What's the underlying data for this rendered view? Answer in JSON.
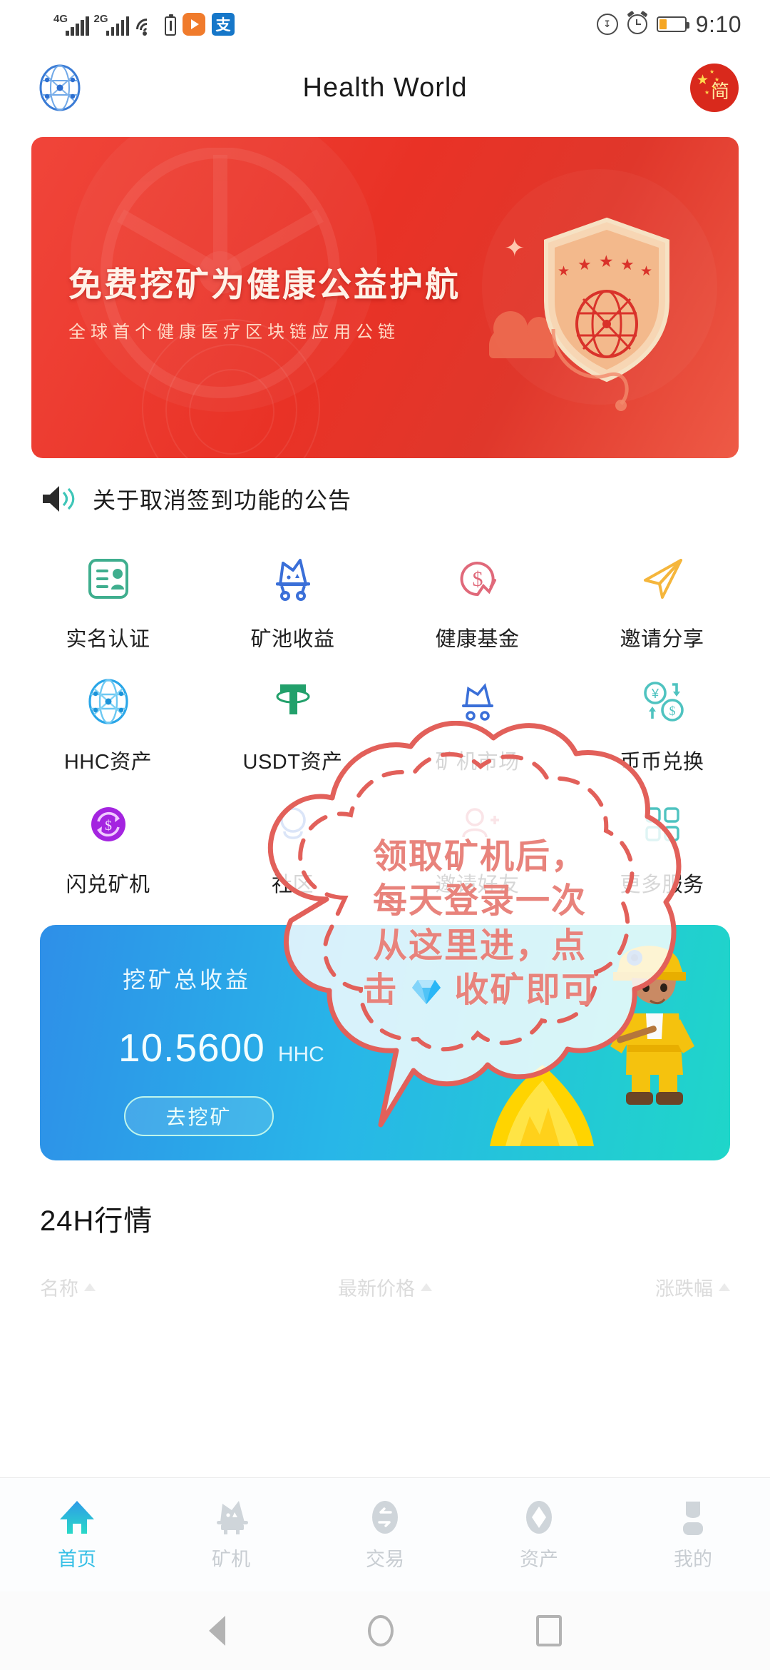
{
  "statusbar": {
    "signal1": "4G",
    "signal2": "2G",
    "wifi_icon": "wifi-icon",
    "battery_icon": "battery-low-icon",
    "app_icons": [
      "video-player-app-icon",
      "alipay-app-icon"
    ],
    "eco_icon": "eco-mode-icon",
    "alarm_icon": "alarm-clock-icon",
    "battery2_icon": "battery-icon",
    "time": "9:10"
  },
  "header": {
    "logo": "hhc-globe-logo",
    "title": "Health World",
    "language_button": "简"
  },
  "banner": {
    "headline": "免费挖矿为健康公益护航",
    "subhead": "全球首个健康医疗区块链应用公链",
    "shield_icon": "shield-badge-icon"
  },
  "announcement": {
    "icon": "speaker-icon",
    "text": "关于取消签到功能的公告"
  },
  "grid": {
    "items": [
      {
        "label": "实名认证",
        "icon": "id-card-icon",
        "color": "#3FAE8E"
      },
      {
        "label": "矿池收益",
        "icon": "mining-cart-icon",
        "color": "#3A6FD8"
      },
      {
        "label": "健康基金",
        "icon": "dollar-fund-icon",
        "color": "#E0697A"
      },
      {
        "label": "邀请分享",
        "icon": "paper-plane-icon",
        "color": "#F5B63C"
      },
      {
        "label": "HHC资产",
        "icon": "hhc-globe-icon",
        "color": "#29A6E8"
      },
      {
        "label": "USDT资产",
        "icon": "usdt-tether-icon",
        "color": "#22A06B"
      },
      {
        "label": "矿机市场",
        "icon": "miner-market-icon",
        "color": "#3A6FD8"
      },
      {
        "label": "币币兑换",
        "icon": "currency-exchange-icon",
        "color": "#4FC3C0"
      },
      {
        "label": "闪兑矿机",
        "icon": "flash-swap-icon",
        "color": "#A424E0"
      },
      {
        "label": "社区",
        "icon": "community-icon",
        "color": "#3A6FD8"
      },
      {
        "label": "邀请好友",
        "icon": "invite-friend-icon",
        "color": "#E0697A"
      },
      {
        "label": "更多服务",
        "icon": "more-services-icon",
        "color": "#4FC3C0"
      }
    ]
  },
  "mining_card": {
    "title": "挖矿总收益",
    "amount": "10.5600",
    "unit": "HHC",
    "button": "去挖矿",
    "miner_icon": "miner-character",
    "gold_icon": "gold-pile"
  },
  "tip_bubble": {
    "line1": "领取矿机后，",
    "line2": "每天登录一次",
    "line3": "从这里进，点",
    "line4_a": "击",
    "line4_b": "收矿即可",
    "gem_icon": "gem-icon",
    "color": "#E8837C"
  },
  "market": {
    "title": "24H行情",
    "columns": [
      "名称",
      "最新价格",
      "涨跌幅"
    ]
  },
  "tabbar": {
    "items": [
      {
        "label": "首页",
        "icon": "home-icon",
        "active": true
      },
      {
        "label": "矿机",
        "icon": "miner-icon",
        "active": false
      },
      {
        "label": "交易",
        "icon": "exchange-icon",
        "active": false
      },
      {
        "label": "资产",
        "icon": "assets-icon",
        "active": false
      },
      {
        "label": "我的",
        "icon": "profile-icon",
        "active": false
      }
    ],
    "active_color": "#36BFE6",
    "inactive_color": "#c8cdd2"
  },
  "navbar": {
    "back": "back-icon",
    "home": "home-circle-icon",
    "recents": "recents-icon"
  }
}
